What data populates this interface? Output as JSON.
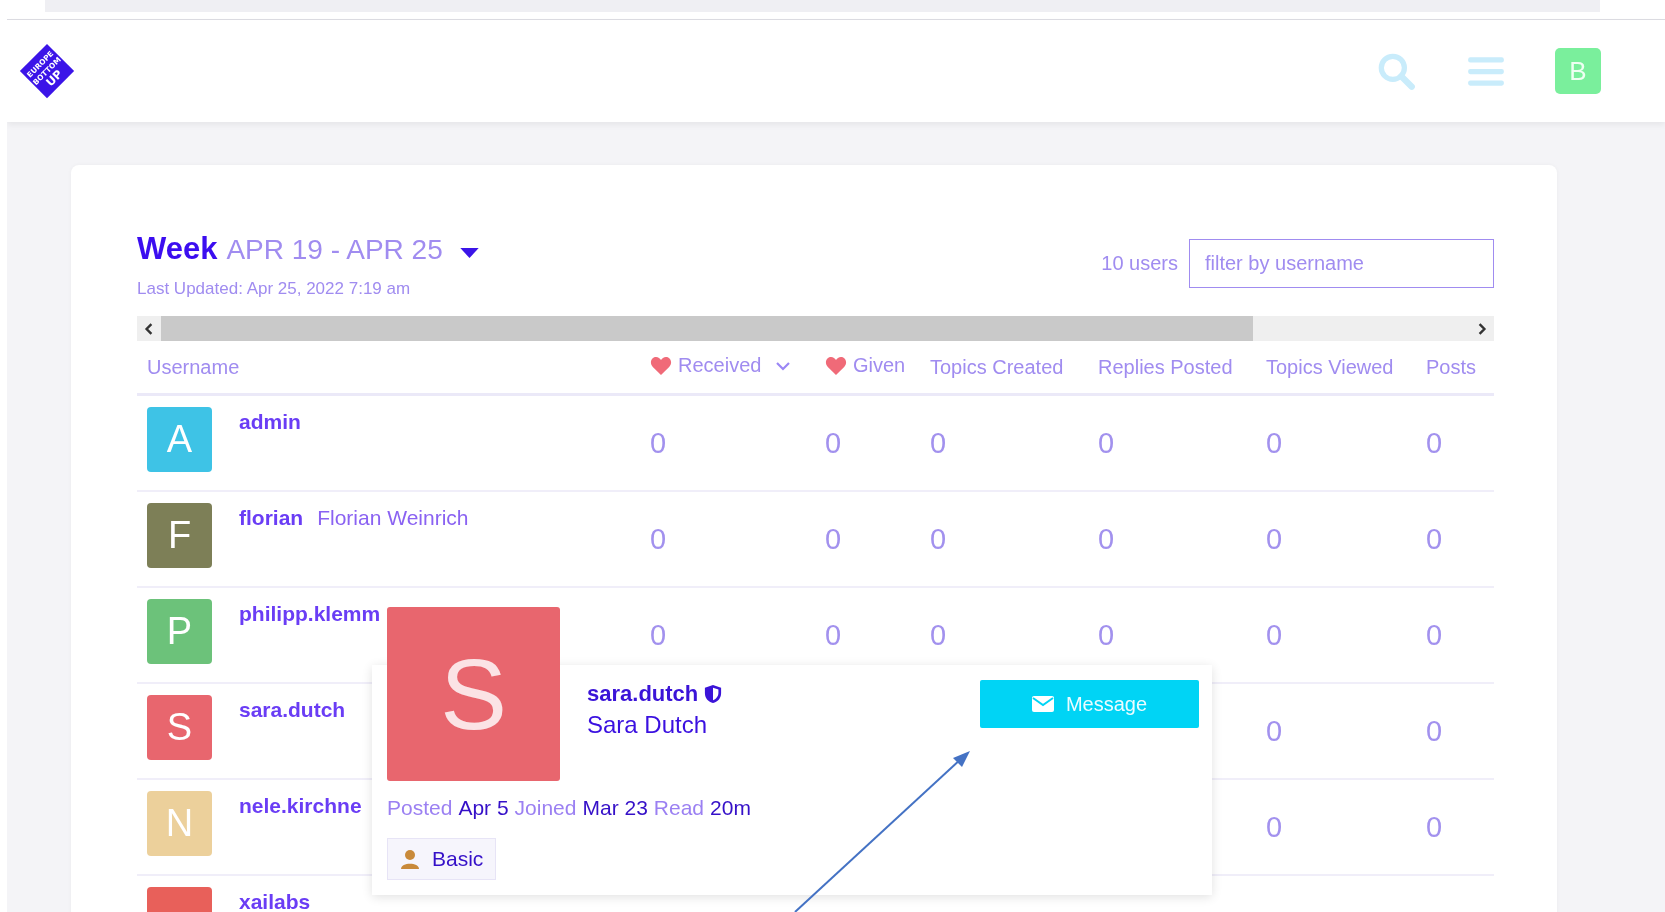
{
  "logo": {
    "text": [
      "EUROPE",
      "BOTTOM",
      "UP"
    ]
  },
  "header": {
    "avatar_letter": "B"
  },
  "period": {
    "label": "Week",
    "range": "APR 19 - APR 25",
    "updated": "Last Updated: Apr 25, 2022 7:19 am"
  },
  "user_count": "10 users",
  "filter": {
    "placeholder": "filter by username"
  },
  "columns": [
    {
      "label": "Username",
      "kind": "name",
      "sorted": false
    },
    {
      "label": "Received",
      "kind": "likes",
      "sorted": true
    },
    {
      "label": "Given",
      "kind": "likes",
      "sorted": false
    },
    {
      "label": "Topics Created",
      "kind": "stat",
      "sorted": false
    },
    {
      "label": "Replies Posted",
      "kind": "stat",
      "sorted": false
    },
    {
      "label": "Topics Viewed",
      "kind": "stat",
      "sorted": false
    },
    {
      "label": "Posts",
      "kind": "stat",
      "sorted": false
    }
  ],
  "rows": [
    {
      "letter": "A",
      "color": "#3ec3e6",
      "username": "admin",
      "values": [
        "0",
        "0",
        "0",
        "0",
        "0",
        "0"
      ]
    },
    {
      "letter": "F",
      "color": "#7d7f57",
      "username": "florian",
      "full_name": "Florian Weinrich",
      "values": [
        "0",
        "0",
        "0",
        "0",
        "0",
        "0"
      ]
    },
    {
      "letter": "P",
      "color": "#6cc27a",
      "username": "philipp.klemm",
      "values": [
        "0",
        "0",
        "0",
        "0",
        "0",
        "0"
      ]
    },
    {
      "letter": "S",
      "color": "#e8666e",
      "username": "sara.dutch",
      "values": [
        "0",
        "0"
      ]
    },
    {
      "letter": "N",
      "color": "#ecd09b",
      "username": "nele.kirchne",
      "values": [
        "0",
        "0"
      ]
    },
    {
      "color": "#e8605a",
      "username": "xailabs"
    }
  ],
  "user_card": {
    "letter": "S",
    "color": "#e8666e",
    "username": "sara.dutch",
    "moderator": true,
    "full_name": "Sara Dutch",
    "message_button": "Message",
    "stats": [
      {
        "label": "Posted",
        "value": "Apr 5"
      },
      {
        "label": "Joined",
        "value": "Mar 23"
      },
      {
        "label": "Read",
        "value": "20m"
      }
    ],
    "badge": "Basic"
  }
}
